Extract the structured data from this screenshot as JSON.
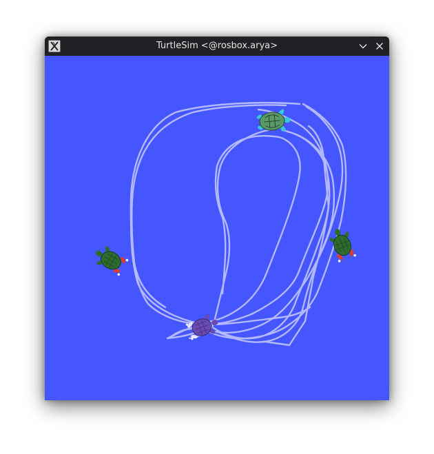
{
  "window": {
    "title": "TurtleSim <@rosbox.arya>",
    "app_icon": "x11-icon",
    "buttons": [
      {
        "name": "minimize",
        "icon": "chevron-down-icon"
      },
      {
        "name": "close",
        "icon": "close-icon"
      }
    ]
  },
  "canvas": {
    "background": "#4656ff",
    "trail_color": "#b3b9ff"
  },
  "turtles": [
    {
      "name": "turtle-top",
      "shell_color": "#5a9a6a",
      "flipper_color": "#36c8d8"
    },
    {
      "name": "turtle-right",
      "shell_color": "#2f6b2f",
      "flipper_color": "#e03a2a"
    },
    {
      "name": "turtle-left",
      "shell_color": "#2f6b2f",
      "flipper_color": "#e03a2a"
    },
    {
      "name": "turtle-bottom",
      "shell_color": "#6a4bb0",
      "flipper_color": "#e6e6ff"
    }
  ]
}
